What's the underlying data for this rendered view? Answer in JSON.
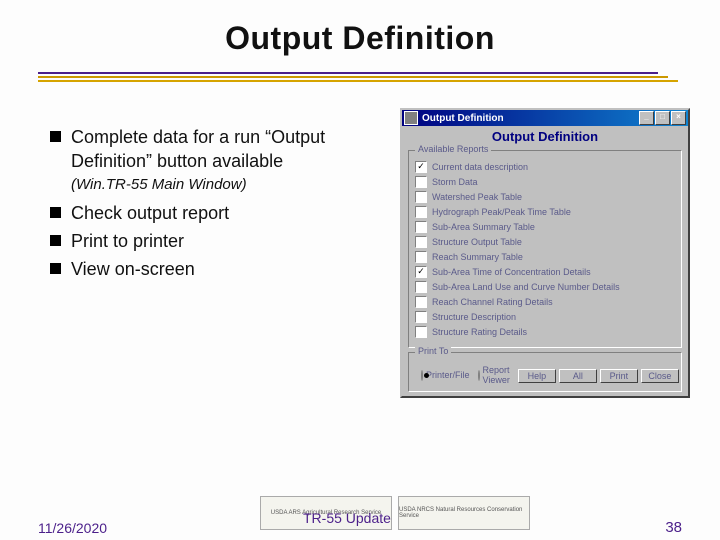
{
  "title": "Output Definition",
  "bullets": [
    {
      "text": "Complete data for a run “Output Definition” button available",
      "sub": "(Win.TR-55 Main Window)"
    },
    {
      "text": "Check output report"
    },
    {
      "text": "Print to printer"
    },
    {
      "text": "View on-screen"
    }
  ],
  "dialog": {
    "title": "Output Definition",
    "heading": "Output Definition",
    "group_reports_label": "Available Reports",
    "reports": [
      {
        "label": "Current data description",
        "checked": true
      },
      {
        "label": "Storm Data",
        "checked": false
      },
      {
        "label": "Watershed Peak Table",
        "checked": false
      },
      {
        "label": "Hydrograph Peak/Peak Time Table",
        "checked": false
      },
      {
        "label": "Sub-Area Summary Table",
        "checked": false
      },
      {
        "label": "Structure Output Table",
        "checked": false
      },
      {
        "label": "Reach Summary Table",
        "checked": false
      },
      {
        "label": "Sub-Area Time of Concentration Details",
        "checked": true
      },
      {
        "label": "Sub-Area Land Use and Curve Number Details",
        "checked": false
      },
      {
        "label": "Reach Channel Rating Details",
        "checked": false
      },
      {
        "label": "Structure Description",
        "checked": false
      },
      {
        "label": "Structure Rating Details",
        "checked": false
      }
    ],
    "group_print_label": "Print To",
    "print_options": [
      {
        "label": "Printer/File",
        "selected": true
      },
      {
        "label": "Report Viewer",
        "selected": false
      }
    ],
    "buttons": {
      "help": "Help",
      "all": "All",
      "print": "Print",
      "close": "Close"
    }
  },
  "footer": {
    "date": "11/26/2020",
    "center": "TR-55 Update",
    "page": "38",
    "logos": [
      "USDA ARS Agricultural Research Service",
      "USDA NRCS Natural Resources Conservation Service"
    ]
  }
}
